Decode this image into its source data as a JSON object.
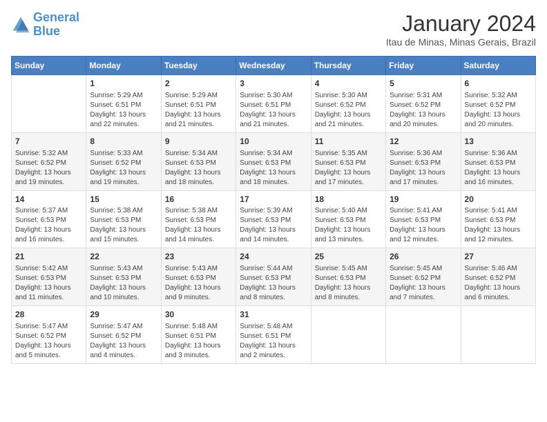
{
  "header": {
    "logo_line1": "General",
    "logo_line2": "Blue",
    "month": "January 2024",
    "location": "Itau de Minas, Minas Gerais, Brazil"
  },
  "days_of_week": [
    "Sunday",
    "Monday",
    "Tuesday",
    "Wednesday",
    "Thursday",
    "Friday",
    "Saturday"
  ],
  "weeks": [
    [
      {
        "day": "",
        "info": ""
      },
      {
        "day": "1",
        "info": "Sunrise: 5:29 AM\nSunset: 6:51 PM\nDaylight: 13 hours\nand 22 minutes."
      },
      {
        "day": "2",
        "info": "Sunrise: 5:29 AM\nSunset: 6:51 PM\nDaylight: 13 hours\nand 21 minutes."
      },
      {
        "day": "3",
        "info": "Sunrise: 5:30 AM\nSunset: 6:51 PM\nDaylight: 13 hours\nand 21 minutes."
      },
      {
        "day": "4",
        "info": "Sunrise: 5:30 AM\nSunset: 6:52 PM\nDaylight: 13 hours\nand 21 minutes."
      },
      {
        "day": "5",
        "info": "Sunrise: 5:31 AM\nSunset: 6:52 PM\nDaylight: 13 hours\nand 20 minutes."
      },
      {
        "day": "6",
        "info": "Sunrise: 5:32 AM\nSunset: 6:52 PM\nDaylight: 13 hours\nand 20 minutes."
      }
    ],
    [
      {
        "day": "7",
        "info": "Sunrise: 5:32 AM\nSunset: 6:52 PM\nDaylight: 13 hours\nand 19 minutes."
      },
      {
        "day": "8",
        "info": "Sunrise: 5:33 AM\nSunset: 6:52 PM\nDaylight: 13 hours\nand 19 minutes."
      },
      {
        "day": "9",
        "info": "Sunrise: 5:34 AM\nSunset: 6:53 PM\nDaylight: 13 hours\nand 18 minutes."
      },
      {
        "day": "10",
        "info": "Sunrise: 5:34 AM\nSunset: 6:53 PM\nDaylight: 13 hours\nand 18 minutes."
      },
      {
        "day": "11",
        "info": "Sunrise: 5:35 AM\nSunset: 6:53 PM\nDaylight: 13 hours\nand 17 minutes."
      },
      {
        "day": "12",
        "info": "Sunrise: 5:36 AM\nSunset: 6:53 PM\nDaylight: 13 hours\nand 17 minutes."
      },
      {
        "day": "13",
        "info": "Sunrise: 5:36 AM\nSunset: 6:53 PM\nDaylight: 13 hours\nand 16 minutes."
      }
    ],
    [
      {
        "day": "14",
        "info": "Sunrise: 5:37 AM\nSunset: 6:53 PM\nDaylight: 13 hours\nand 16 minutes."
      },
      {
        "day": "15",
        "info": "Sunrise: 5:38 AM\nSunset: 6:53 PM\nDaylight: 13 hours\nand 15 minutes."
      },
      {
        "day": "16",
        "info": "Sunrise: 5:38 AM\nSunset: 6:53 PM\nDaylight: 13 hours\nand 14 minutes."
      },
      {
        "day": "17",
        "info": "Sunrise: 5:39 AM\nSunset: 6:53 PM\nDaylight: 13 hours\nand 14 minutes."
      },
      {
        "day": "18",
        "info": "Sunrise: 5:40 AM\nSunset: 6:53 PM\nDaylight: 13 hours\nand 13 minutes."
      },
      {
        "day": "19",
        "info": "Sunrise: 5:41 AM\nSunset: 6:53 PM\nDaylight: 13 hours\nand 12 minutes."
      },
      {
        "day": "20",
        "info": "Sunrise: 5:41 AM\nSunset: 6:53 PM\nDaylight: 13 hours\nand 12 minutes."
      }
    ],
    [
      {
        "day": "21",
        "info": "Sunrise: 5:42 AM\nSunset: 6:53 PM\nDaylight: 13 hours\nand 11 minutes."
      },
      {
        "day": "22",
        "info": "Sunrise: 5:43 AM\nSunset: 6:53 PM\nDaylight: 13 hours\nand 10 minutes."
      },
      {
        "day": "23",
        "info": "Sunrise: 5:43 AM\nSunset: 6:53 PM\nDaylight: 13 hours\nand 9 minutes."
      },
      {
        "day": "24",
        "info": "Sunrise: 5:44 AM\nSunset: 6:53 PM\nDaylight: 13 hours\nand 8 minutes."
      },
      {
        "day": "25",
        "info": "Sunrise: 5:45 AM\nSunset: 6:53 PM\nDaylight: 13 hours\nand 8 minutes."
      },
      {
        "day": "26",
        "info": "Sunrise: 5:45 AM\nSunset: 6:52 PM\nDaylight: 13 hours\nand 7 minutes."
      },
      {
        "day": "27",
        "info": "Sunrise: 5:46 AM\nSunset: 6:52 PM\nDaylight: 13 hours\nand 6 minutes."
      }
    ],
    [
      {
        "day": "28",
        "info": "Sunrise: 5:47 AM\nSunset: 6:52 PM\nDaylight: 13 hours\nand 5 minutes."
      },
      {
        "day": "29",
        "info": "Sunrise: 5:47 AM\nSunset: 6:52 PM\nDaylight: 13 hours\nand 4 minutes."
      },
      {
        "day": "30",
        "info": "Sunrise: 5:48 AM\nSunset: 6:51 PM\nDaylight: 13 hours\nand 3 minutes."
      },
      {
        "day": "31",
        "info": "Sunrise: 5:48 AM\nSunset: 6:51 PM\nDaylight: 13 hours\nand 2 minutes."
      },
      {
        "day": "",
        "info": ""
      },
      {
        "day": "",
        "info": ""
      },
      {
        "day": "",
        "info": ""
      }
    ]
  ]
}
